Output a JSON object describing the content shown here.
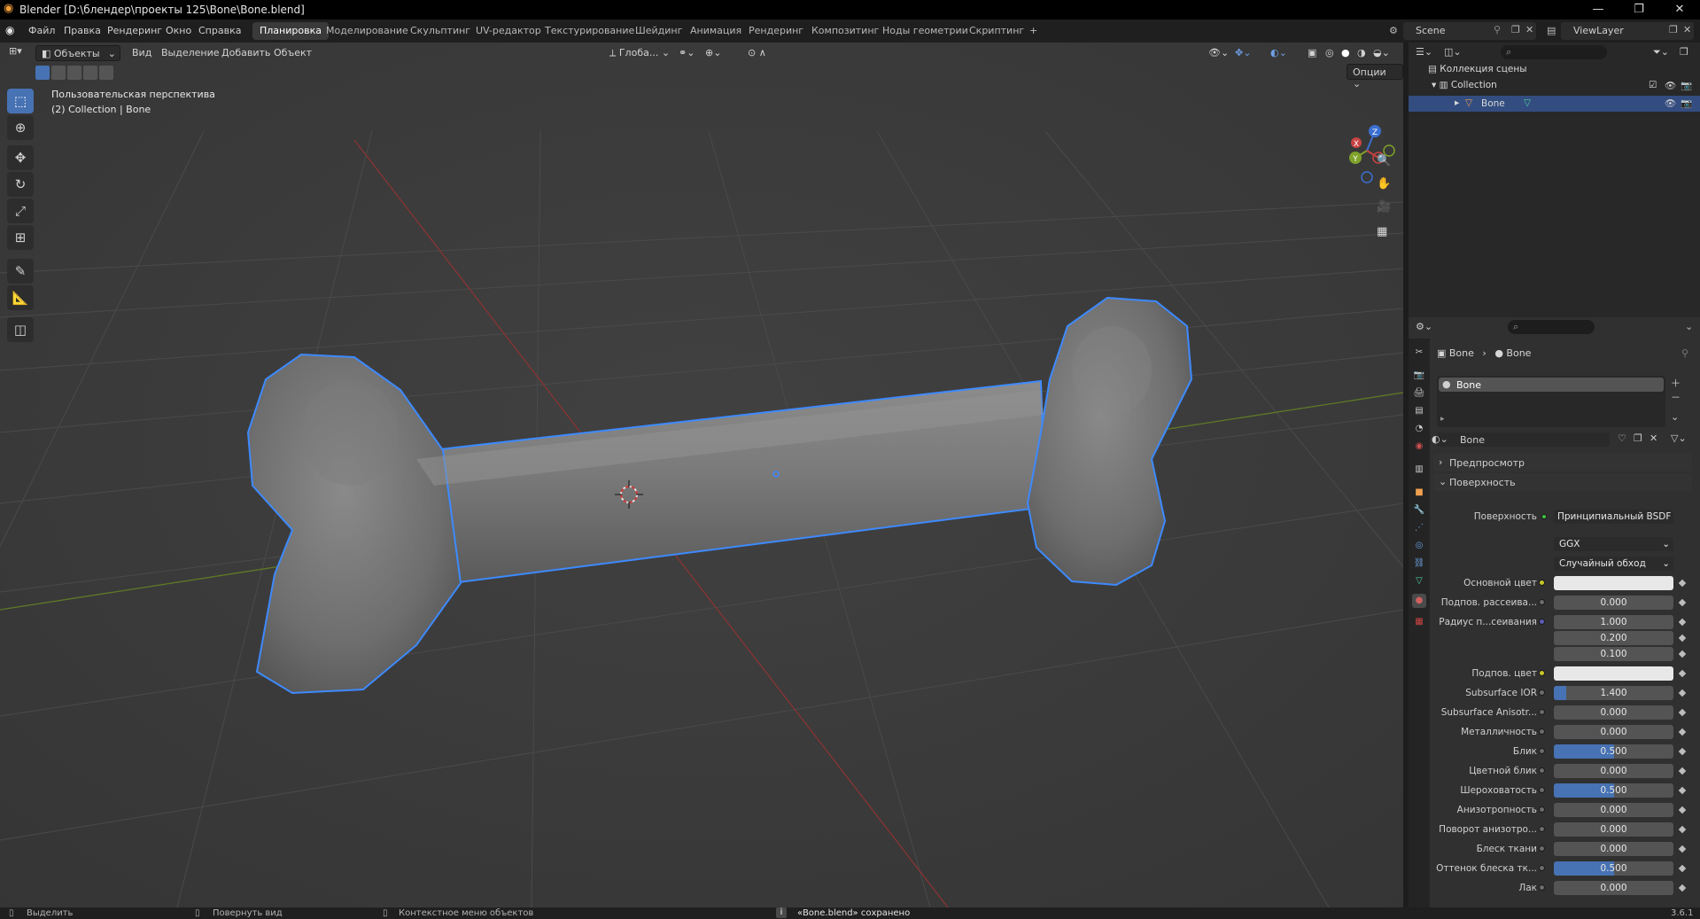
{
  "window": {
    "title": "Blender [D:\\блендер\\проекты 125\\Bone\\Bone.blend]",
    "minimize": "—",
    "maximize": "❐",
    "close": "✕"
  },
  "menu": [
    "Файл",
    "Правка",
    "Рендеринг",
    "Окно",
    "Справка"
  ],
  "workspaces": [
    "Планировка",
    "Моделирование",
    "Скульптинг",
    "UV-редактор",
    "Текстурирование",
    "Шейдинг",
    "Анимация",
    "Рендеринг",
    "Композитинг",
    "Ноды геометрии",
    "Скриптинг"
  ],
  "add_workspace": "+",
  "scene": {
    "label": "Scene",
    "viewlayer": "ViewLayer"
  },
  "viewport": {
    "mode": "Объекты",
    "menus": [
      "Вид",
      "Выделение",
      "Добавить",
      "Объект"
    ],
    "orientation": "Глоба...",
    "options": "Опции",
    "view_name": "Пользовательская перспектива",
    "object_info": "(2) Collection | Bone",
    "gizmo_axes": [
      "X",
      "Y",
      "Z"
    ]
  },
  "outliner": {
    "root": "Коллекция сцены",
    "collection": "Collection",
    "object": "Bone"
  },
  "properties": {
    "breadcrumb": [
      "Bone",
      "Bone"
    ],
    "material_slot": "Bone",
    "material_name": "Bone",
    "panels": {
      "preview": "Предпросмотр",
      "surface": "Поверхность"
    },
    "surface_label": "Поверхность",
    "surface_value": "Принципиальный BSDF",
    "dist": "GGX",
    "subsurface_method": "Случайный обход",
    "rows": [
      {
        "label": "Основной цвет",
        "value": "",
        "swatch": "#e8e8e8",
        "dot": "y"
      },
      {
        "label": "Подпов. рассеива...",
        "value": "0.000",
        "dot": ""
      },
      {
        "label": "Радиус п...сеивания",
        "value": "1.000",
        "dot": "b"
      },
      {
        "label": "",
        "value": "0.200",
        "dot": "none"
      },
      {
        "label": "",
        "value": "0.100",
        "dot": "none"
      },
      {
        "label": "Подпов. цвет",
        "value": "",
        "swatch": "#e8e8e8",
        "dot": "y"
      },
      {
        "label": "Subsurface IOR",
        "value": "1.400",
        "fill": 0.1,
        "dot": ""
      },
      {
        "label": "Subsurface Anisotr...",
        "value": "0.000",
        "dot": ""
      },
      {
        "label": "Металличность",
        "value": "0.000",
        "dot": ""
      },
      {
        "label": "Блик",
        "value": "0.500",
        "fill": 0.5,
        "dot": ""
      },
      {
        "label": "Цветной блик",
        "value": "0.000",
        "dot": ""
      },
      {
        "label": "Шероховатость",
        "value": "0.500",
        "fill": 0.5,
        "dot": ""
      },
      {
        "label": "Анизотропность",
        "value": "0.000",
        "dot": ""
      },
      {
        "label": "Поворот анизотро...",
        "value": "0.000",
        "dot": ""
      },
      {
        "label": "Блеск ткани",
        "value": "0.000",
        "dot": ""
      },
      {
        "label": "Оттенок блеска тк...",
        "value": "0.500",
        "fill": 0.5,
        "dot": ""
      },
      {
        "label": "Лак",
        "value": "0.000",
        "dot": ""
      }
    ]
  },
  "status": {
    "select": "Выделить",
    "rotate": "Повернуть вид",
    "context": "Контекстное меню объектов",
    "message": "«Bone.blend» сохранено",
    "version": "3.6.1"
  },
  "colors": {
    "accent": "#4772b3",
    "selection_outline": "#3d8aff",
    "x_axis": "#c83c3c",
    "y_axis": "#7a9a2a"
  }
}
